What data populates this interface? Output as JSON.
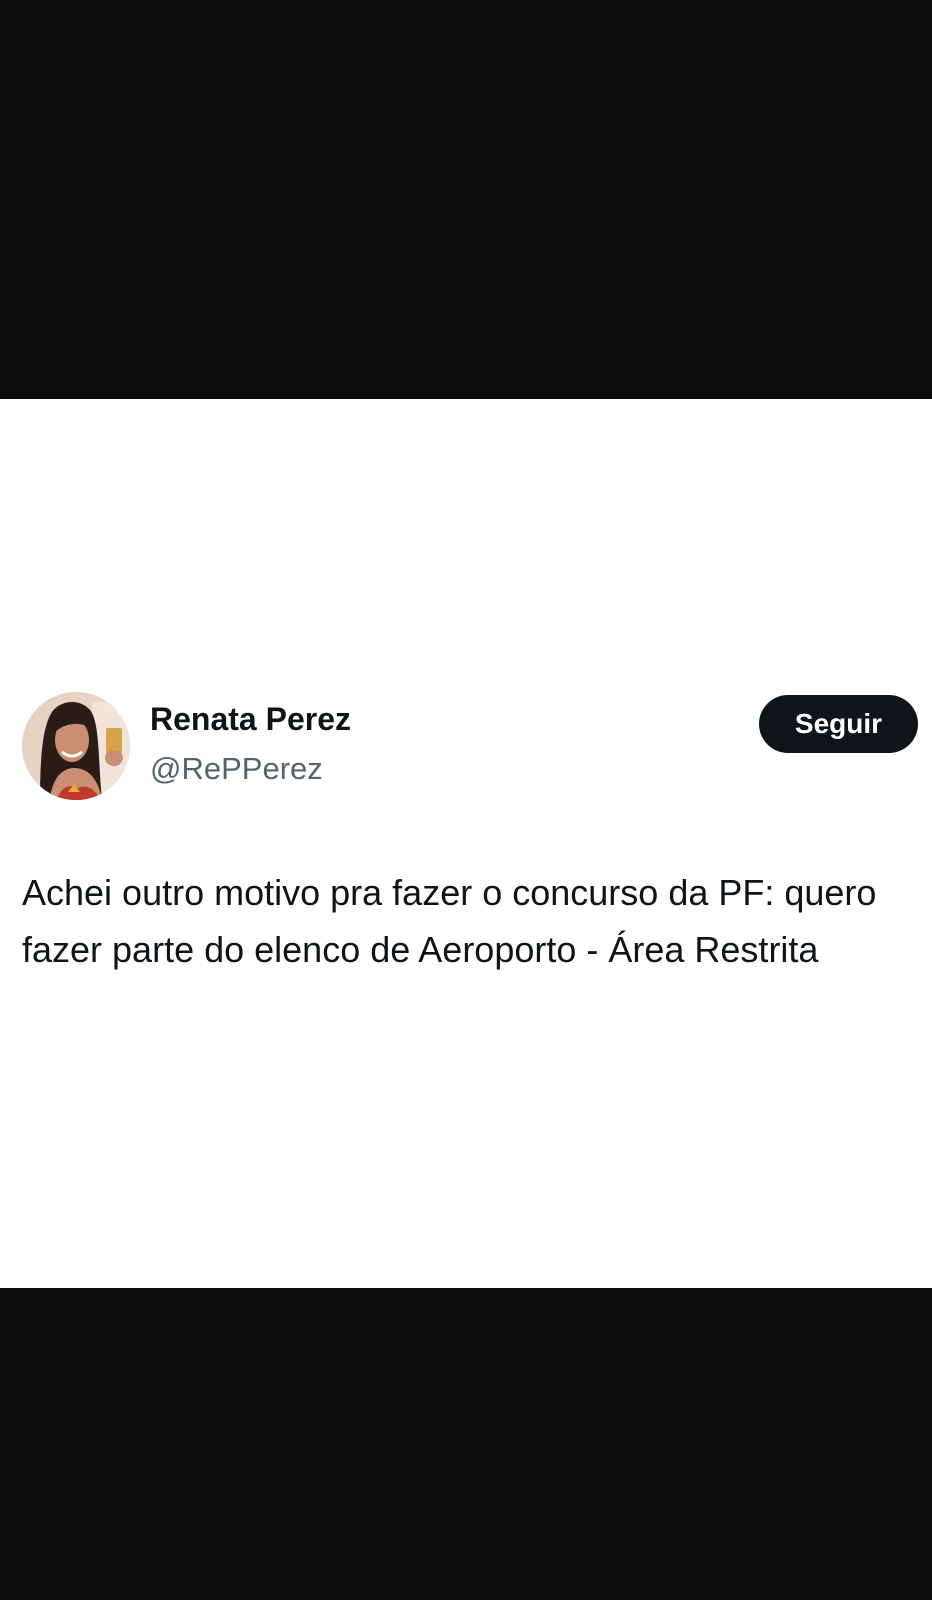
{
  "tweet": {
    "author": {
      "name": "Renata Perez",
      "handle": "@RePPerez"
    },
    "follow_label": "Seguir",
    "text": "Achei outro motivo pra fazer o concurso da PF: quero fazer parte do elenco de Aeroporto - Área Restrita"
  },
  "colors": {
    "background_bars": "#0b0b0c",
    "card": "#ffffff",
    "text_primary": "#0f1419",
    "text_secondary": "#536471",
    "button_bg": "#0f1419",
    "button_text": "#ffffff"
  }
}
